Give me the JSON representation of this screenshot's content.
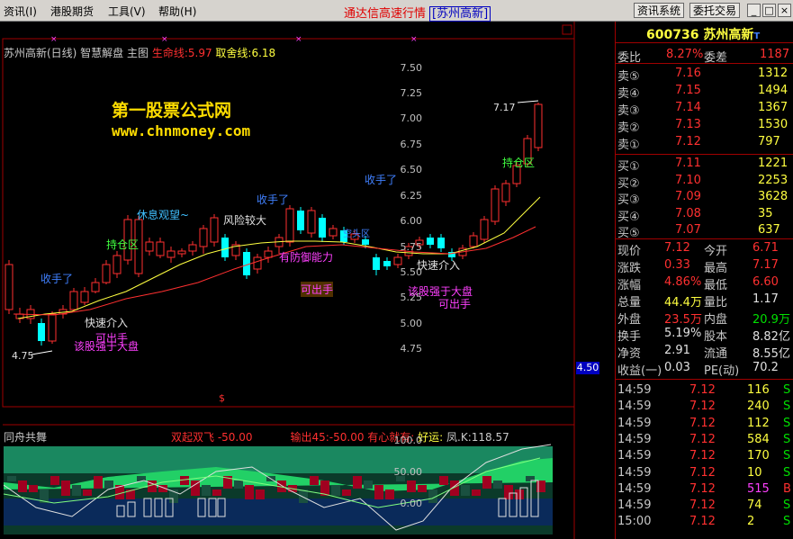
{
  "menu": {
    "items": [
      "资讯(I)",
      "港股期货",
      "工具(V)",
      "帮助(H)"
    ],
    "app_title": "通达信高速行情",
    "app_stock": "[苏州高新]",
    "btn_info": "资讯系统",
    "btn_trade": "委托交易",
    "win_min": "_",
    "win_max": "□",
    "win_close": "×"
  },
  "chart": {
    "info_name": "苏州高新(日线) 智慧解盘 主图",
    "info_life": "生命线:5.97",
    "info_drop": "取舍线:6.18",
    "watermark1": "第一股票公式网",
    "watermark2": "www.chnmoney.com",
    "y_labels": [
      "7.50",
      "7.25",
      "7.00",
      "6.75",
      "6.50",
      "6.25",
      "6.00",
      "5.75",
      "5.50",
      "5.25",
      "5.00",
      "4.75"
    ],
    "price_tag": "4.50",
    "low_label": "4.75",
    "high_label": "7.17",
    "dollar": "$",
    "annotations": [
      {
        "text": "收手了",
        "color": "#4080ff"
      },
      {
        "text": "持仓区",
        "color": "#40ff40"
      },
      {
        "text": "休息观望~",
        "color": "#40c0ff"
      },
      {
        "text": "收手了",
        "color": "#4080ff"
      },
      {
        "text": "风险较大",
        "color": "#e0e0e0"
      },
      {
        "text": "收手了",
        "color": "#4080ff"
      },
      {
        "text": "有防御能力",
        "color": "#ff40ff"
      },
      {
        "text": "可出手",
        "color": "#ff40ff"
      },
      {
        "text": "持仓区",
        "color": "#40ff40"
      },
      {
        "text": "快速介入",
        "color": "#e0e0e0"
      },
      {
        "text": "该股强于大盘",
        "color": "#ff40ff"
      },
      {
        "text": "可出手",
        "color": "#ff40ff"
      },
      {
        "text": "快速介入",
        "color": "#e0e0e0"
      },
      {
        "text": "可出手",
        "color": "#ff40ff"
      },
      {
        "text": "该股强于大盘",
        "color": "#ff40ff"
      },
      {
        "text": "空头区",
        "color": "#4080ff"
      }
    ]
  },
  "indicator": {
    "title": "同舟共舞",
    "f1": "双起双飞 -50.00",
    "f2": "输出45:-50.00",
    "f3": "有心就有:",
    "f4": "好运:",
    "f5": "凤.K:118.57",
    "y_labels": [
      "100.0",
      "50.00",
      "0.00"
    ]
  },
  "quote": {
    "code": "600736",
    "name": "苏州高新",
    "weibi_label": "委比",
    "weibi": "8.27%",
    "weicha_label": "委差",
    "weicha": "1187",
    "asks": [
      {
        "label": "卖⑤",
        "price": "7.16",
        "vol": "1312"
      },
      {
        "label": "卖④",
        "price": "7.15",
        "vol": "1494"
      },
      {
        "label": "卖③",
        "price": "7.14",
        "vol": "1367"
      },
      {
        "label": "卖②",
        "price": "7.13",
        "vol": "1530"
      },
      {
        "label": "卖①",
        "price": "7.12",
        "vol": "797"
      }
    ],
    "bids": [
      {
        "label": "买①",
        "price": "7.11",
        "vol": "1221"
      },
      {
        "label": "买②",
        "price": "7.10",
        "vol": "2253"
      },
      {
        "label": "买③",
        "price": "7.09",
        "vol": "3628"
      },
      {
        "label": "买④",
        "price": "7.08",
        "vol": "35"
      },
      {
        "label": "买⑤",
        "price": "7.07",
        "vol": "637"
      }
    ],
    "stats": [
      {
        "l1": "现价",
        "v1": "7.12",
        "l2": "今开",
        "v2": "6.71"
      },
      {
        "l1": "涨跌",
        "v1": "0.33",
        "l2": "最高",
        "v2": "7.17"
      },
      {
        "l1": "涨幅",
        "v1": "4.86%",
        "l2": "最低",
        "v2": "6.60"
      },
      {
        "l1": "总量",
        "v1": "44.4万",
        "l2": "量比",
        "v2": "1.17"
      },
      {
        "l1": "外盘",
        "v1": "23.5万",
        "l2": "内盘",
        "v2": "20.9万"
      },
      {
        "l1": "换手",
        "v1": "5.19%",
        "l2": "股本",
        "v2": "8.82亿"
      },
      {
        "l1": "净资",
        "v1": "2.91",
        "l2": "流通",
        "v2": "8.55亿"
      },
      {
        "l1": "收益(一)",
        "v1": "0.03",
        "l2": "PE(动)",
        "v2": "70.2"
      }
    ],
    "ticks": [
      {
        "time": "14:59",
        "price": "7.12",
        "vol": "116",
        "side": "S"
      },
      {
        "time": "14:59",
        "price": "7.12",
        "vol": "240",
        "side": "S"
      },
      {
        "time": "14:59",
        "price": "7.12",
        "vol": "112",
        "side": "S"
      },
      {
        "time": "14:59",
        "price": "7.12",
        "vol": "584",
        "side": "S"
      },
      {
        "time": "14:59",
        "price": "7.12",
        "vol": "170",
        "side": "S"
      },
      {
        "time": "14:59",
        "price": "7.12",
        "vol": "10",
        "side": "S"
      },
      {
        "time": "14:59",
        "price": "7.12",
        "vol": "515",
        "side": "B"
      },
      {
        "time": "14:59",
        "price": "7.12",
        "vol": "74",
        "side": "S"
      },
      {
        "time": "15:00",
        "price": "7.12",
        "vol": "2",
        "side": "S"
      }
    ]
  },
  "colors": {
    "up": "#ff3030",
    "down": "#00ffff",
    "bg": "#000000",
    "border": "#a00000"
  }
}
